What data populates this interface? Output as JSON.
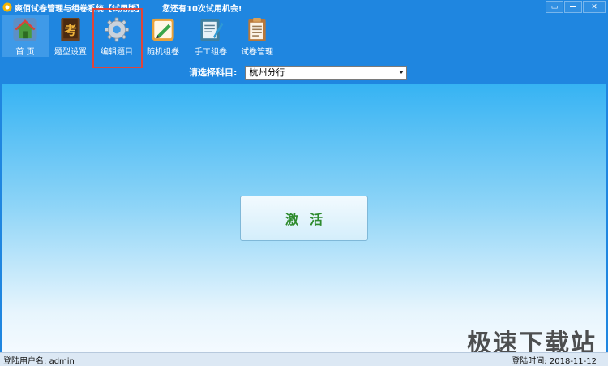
{
  "window": {
    "title": "爽佰试卷管理与组卷系统【试用版】",
    "trial_message": "您还有10次试用机会!",
    "controls": {
      "restore": "▭",
      "minimize": "—",
      "close": "✕"
    }
  },
  "toolbar": {
    "items": [
      {
        "label": "首 页",
        "icon": "home-icon"
      },
      {
        "label": "题型设置",
        "icon": "exam-book-icon"
      },
      {
        "label": "编辑题目",
        "icon": "gear-icon"
      },
      {
        "label": "随机组卷",
        "icon": "pencil-note-icon"
      },
      {
        "label": "手工组卷",
        "icon": "notepad-icon"
      },
      {
        "label": "试卷管理",
        "icon": "clipboard-icon"
      }
    ],
    "active_index": 0,
    "highlight_index": 2
  },
  "subject": {
    "label": "请选择科目:",
    "selected": "杭州分行"
  },
  "main": {
    "activate_label": "激活"
  },
  "watermark": "极速下载站",
  "status": {
    "user_label": "登陆用户名:",
    "user_value": "admin",
    "time_label": "登陆时间:",
    "time_value": "2018-11-12"
  },
  "colors": {
    "title_bar": "#1f86e0",
    "highlight": "#e0453a",
    "activate_text": "#2e8b2e"
  }
}
